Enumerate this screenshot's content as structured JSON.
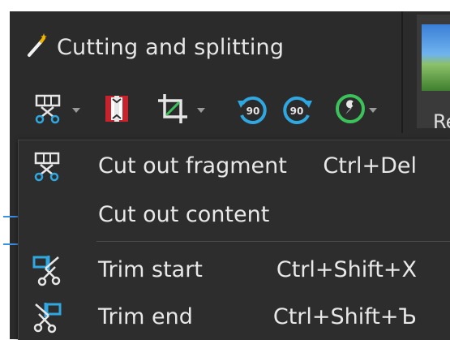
{
  "header": {
    "title": "Cutting and splitting",
    "icon": "magic-wand-icon"
  },
  "thumbnail": {
    "label": "Re"
  },
  "toolbar": {
    "buttons": [
      {
        "name": "cut-fragment-tool",
        "icon": "scissors-frame-icon",
        "has_dropdown": true
      },
      {
        "name": "split-tool",
        "icon": "split-clip-icon",
        "has_dropdown": false
      },
      {
        "name": "crop-tool",
        "icon": "crop-icon",
        "has_dropdown": true
      },
      {
        "name": "rotate-left-tool",
        "icon": "rotate-left-icon",
        "label": "90",
        "has_dropdown": false
      },
      {
        "name": "rotate-right-tool",
        "icon": "rotate-right-icon",
        "label": "90",
        "has_dropdown": false
      },
      {
        "name": "tools-menu",
        "icon": "wrench-icon",
        "has_dropdown": true
      }
    ]
  },
  "menu": {
    "items": [
      {
        "label": "Cut out fragment",
        "shortcut": "Ctrl+Del",
        "icon": "scissors-frame-icon"
      },
      {
        "label": "Cut out content",
        "shortcut": "",
        "icon": ""
      },
      {
        "label": "Trim start",
        "shortcut": "Ctrl+Shift+X",
        "icon": "trim-start-icon"
      },
      {
        "label": "Trim end",
        "shortcut": "Ctrl+Shift+Ъ",
        "icon": "trim-end-icon"
      }
    ]
  },
  "colors": {
    "background": "#2b2b2b",
    "menu_bg": "#2d2d2d",
    "accent_blue": "#2fa7e0",
    "accent_green": "#3cc25a",
    "accent_red": "#c8232c",
    "text": "#e8e8e8"
  }
}
